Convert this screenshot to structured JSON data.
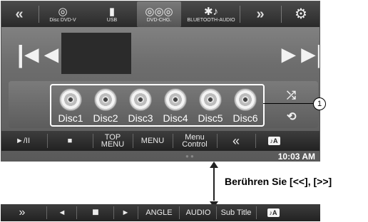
{
  "topbar": {
    "left_chevron": "«",
    "right_chevron": "»",
    "sources": [
      {
        "label": "Disc DVD-V",
        "icon": "disc-icon"
      },
      {
        "label": "USB",
        "icon": "usb-icon"
      },
      {
        "label": "DVD-CHG.",
        "icon": "disc-changer-icon"
      },
      {
        "label": "BLUETOOTH-AUDIO",
        "icon": "bluetooth-audio-icon"
      }
    ],
    "setup_icon": "setup-icon"
  },
  "player": {
    "prev_icon": "skip-previous-icon",
    "next_icon": "skip-next-icon"
  },
  "discs": [
    "Disc1",
    "Disc2",
    "Disc3",
    "Disc4",
    "Disc5",
    "Disc6"
  ],
  "side_controls": {
    "shuffle_icon": "shuffle-icon",
    "repeat_icon": "repeat-icon"
  },
  "bottombar": {
    "play_pause": "►/II",
    "stop": "■",
    "top_menu": "TOP MENU",
    "menu": "MENU",
    "menu_control": "Menu Control",
    "prev_page": "«",
    "music_mode": "♪A"
  },
  "clock": "10:03 AM",
  "callout_number": "1",
  "caption": "Berühren Sie [<<], [>>]",
  "bar2": {
    "next_page": "»",
    "prev": "◄",
    "stop": "■",
    "play": "►",
    "angle": "ANGLE",
    "audio": "AUDIO",
    "subtitle": "Sub Title",
    "music_mode": "♪A"
  }
}
